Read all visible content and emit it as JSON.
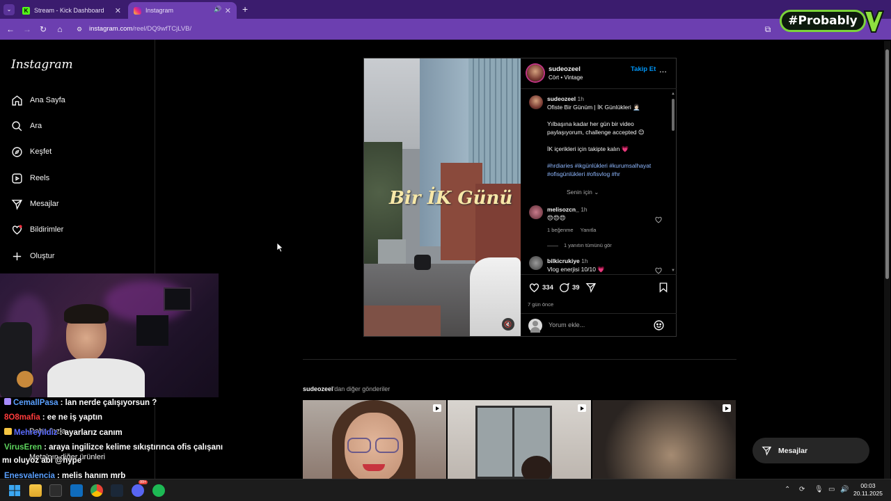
{
  "browser": {
    "tabs": [
      {
        "label": "Stream - Kick Dashboard",
        "favicon": "kick-icon",
        "active": false
      },
      {
        "label": "Instagram",
        "favicon": "instagram-icon",
        "active": true
      }
    ],
    "url_host": "instagram.com",
    "url_path": "/reel/DQ9wfTCjLVB/",
    "new_tab_label": "+"
  },
  "overlay": {
    "badge_text": "#Probably"
  },
  "sidebar": {
    "logo": "Instagram",
    "items": [
      {
        "label": "Ana Sayfa",
        "icon": "home-icon"
      },
      {
        "label": "Ara",
        "icon": "search-icon"
      },
      {
        "label": "Keşfet",
        "icon": "compass-icon"
      },
      {
        "label": "Reels",
        "icon": "reels-icon"
      },
      {
        "label": "Mesajlar",
        "icon": "send-icon"
      },
      {
        "label": "Bildirimler",
        "icon": "heart-icon"
      },
      {
        "label": "Oluştur",
        "icon": "plus-icon"
      }
    ],
    "hidden_more": "Daha fazla",
    "hidden_meta": "Meta'nın diğer ürünleri"
  },
  "chat": [
    {
      "user": "CemallPasa",
      "color": "#5aa0ff",
      "badge": "#a78bfa",
      "text": ": lan nerde çalışıyorsun ?"
    },
    {
      "user": "8O8mafia",
      "color": "#ff3b3b",
      "badge": "",
      "text": ": ee ne iş yaptın"
    },
    {
      "user": "Mehreyildiz",
      "color": "#5b6cff",
      "badge": "#f5c542",
      "text": ": ayarlarız canım"
    },
    {
      "user": "VirusEren",
      "color": "#5dd55d",
      "badge": "",
      "text": ": araya ingilizce kelime sıkıştırınca ofis çalışanı"
    },
    {
      "user": "",
      "color": "#ffffff",
      "badge": "",
      "text": "mı oluyoz abi @hype"
    },
    {
      "user": "Enesvalencia",
      "color": "#5aa0ff",
      "badge": "",
      "text": ": melis hanım mrb"
    }
  ],
  "post": {
    "video_title": "Bir İK Günü",
    "username": "sudeozeel",
    "audio": "Cört • Vintage",
    "follow_label": "Takip Et",
    "more_label": "...",
    "caption_user": "sudeozeel",
    "caption_time": "1h",
    "caption_lines": [
      "Ofiste Bir Günüm | İK Günlükleri 👩🏻‍💼",
      "Yılbaşına kadar her gün bir video",
      "paylaşıyorum, challenge accepted 😊",
      "İK içerikleri için takipte kalın 💗"
    ],
    "hashtags_1": "#hrdiaries #ikgünlükleri #kurumsalhayat",
    "hashtags_2": "#ofisgünlükleri #ofisvlog #hr",
    "for_you": "Senin için",
    "comments": [
      {
        "user": "melisozcn_",
        "time": "1h",
        "text": "😍😍😍",
        "likes": "1 beğenme",
        "reply": "Yanıtla"
      },
      {
        "user": "bilkicrukiye",
        "time": "1h",
        "text": "Vlog enerjisi 10/10 💗"
      }
    ],
    "view_replies": "1 yanıtın tümünü gör",
    "like_count": "334",
    "comment_count": "39",
    "posted_ago": "7 gün önce",
    "add_comment_placeholder": "Yorum ekle..."
  },
  "more_posts": {
    "user": "sudeozeel",
    "suffix": "'dan diğer gönderiler"
  },
  "messages_button": "Mesajlar",
  "taskbar": {
    "time": "00:03",
    "date": "20.11.2025",
    "discord_badge": "99+"
  }
}
